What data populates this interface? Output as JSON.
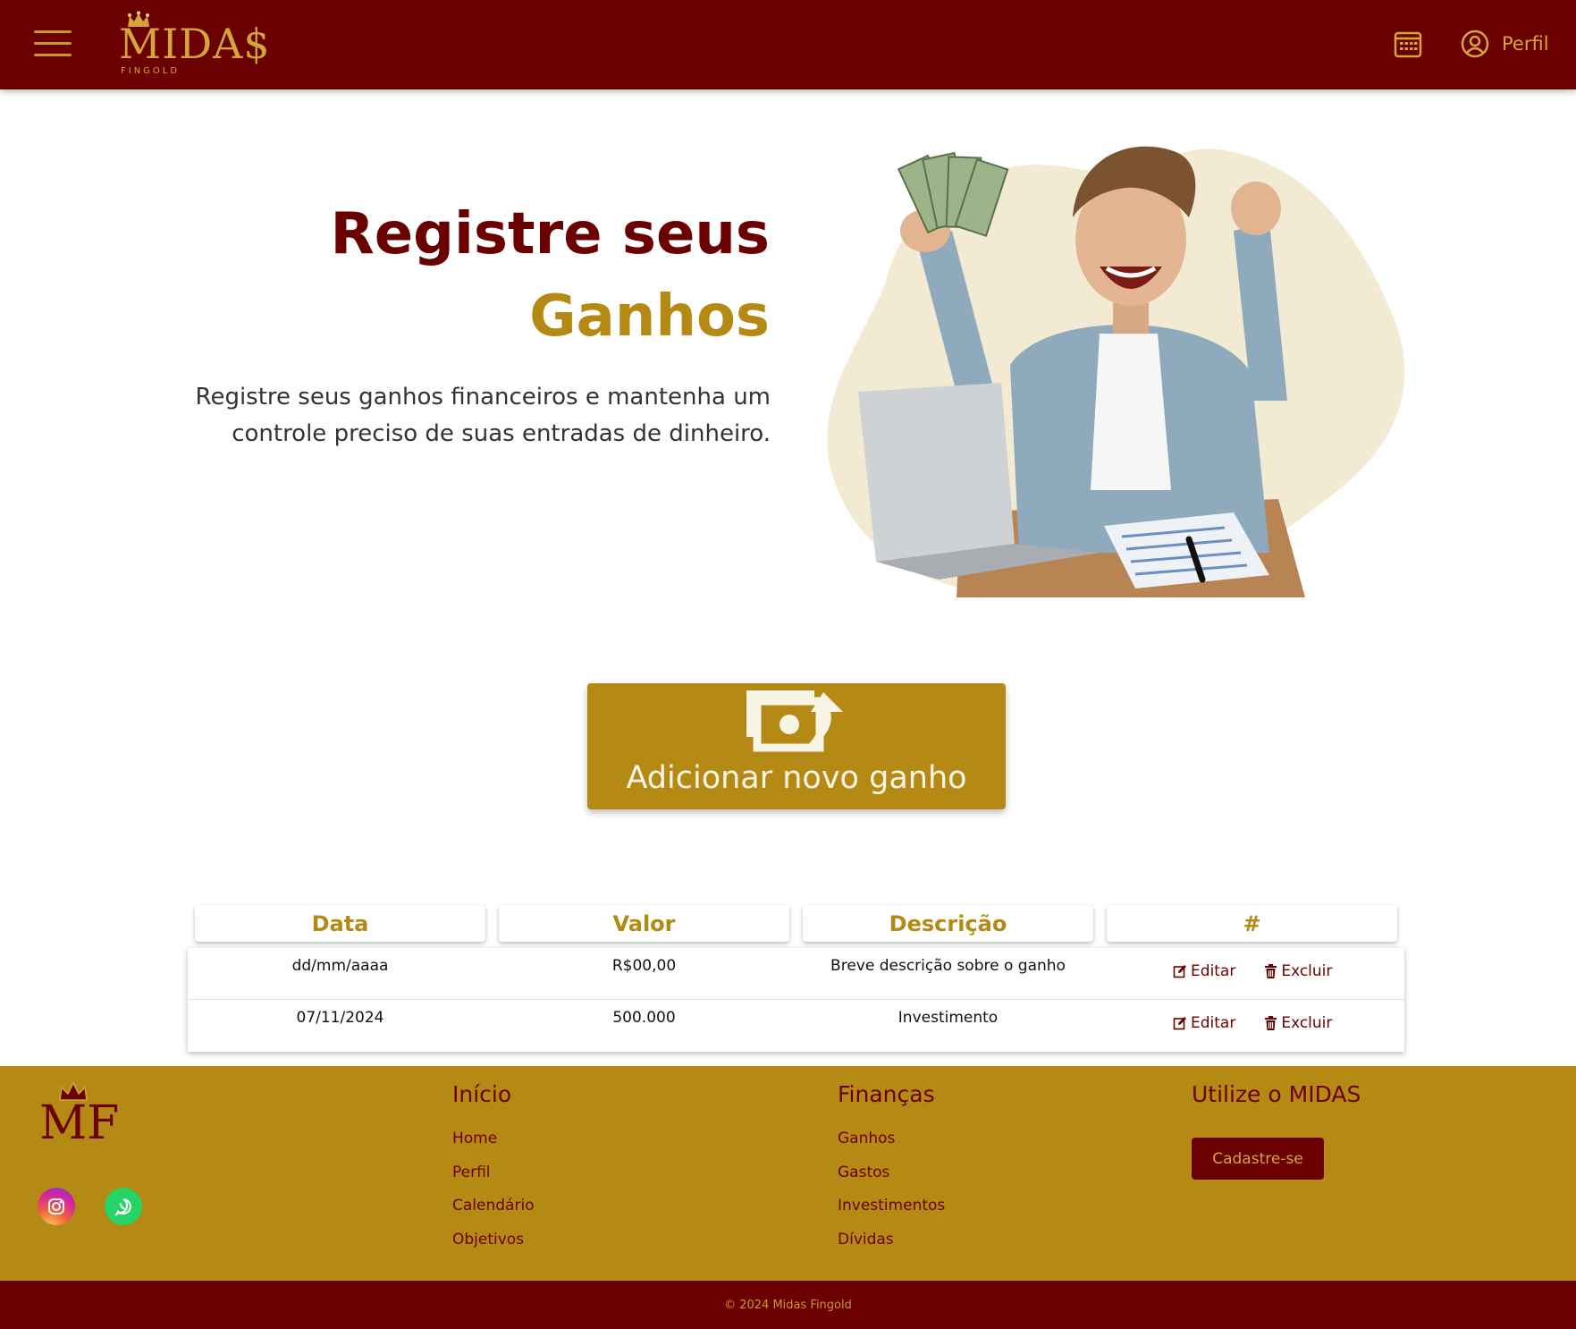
{
  "header": {
    "logo_text": "MIDA$",
    "logo_subtext": "FINGOLD",
    "calendar_icon": "calendar-icon",
    "profile_label": "Perfil"
  },
  "hero": {
    "title_line1": "Registre seus",
    "title_line2": "Ganhos",
    "description": "Registre seus ganhos financeiros e mantenha um controle preciso de suas entradas de dinheiro."
  },
  "add_button": {
    "label": "Adicionar novo ganho",
    "icon": "money-exchange-icon"
  },
  "table": {
    "columns": [
      "Data",
      "Valor",
      "Descrição",
      "#"
    ],
    "rows": [
      {
        "date": "dd/mm/aaaa",
        "value": "R$00,00",
        "description": "Breve descrição sobre o ganho",
        "edit": "Editar",
        "delete": "Excluir"
      },
      {
        "date": "07/11/2024",
        "value": "500.000",
        "description": "Investimento",
        "edit": "Editar",
        "delete": "Excluir"
      }
    ]
  },
  "footer": {
    "logo_text": "MF",
    "columns": [
      {
        "title": "Início",
        "links": [
          "Home",
          "Perfil",
          "Calendário",
          "Objetivos"
        ]
      },
      {
        "title": "Finanças",
        "links": [
          "Ganhos",
          "Gastos",
          "Investimentos",
          "Dívidas"
        ]
      },
      {
        "title": "Utilize o MIDAS",
        "button": "Cadastre-se"
      }
    ],
    "social": [
      "instagram-icon",
      "whatsapp-icon"
    ],
    "copyright": "© 2024 Midas Fingold"
  },
  "colors": {
    "primary": "#6b0000",
    "gold": "#b58a14",
    "light_gold": "#d4a53a"
  }
}
